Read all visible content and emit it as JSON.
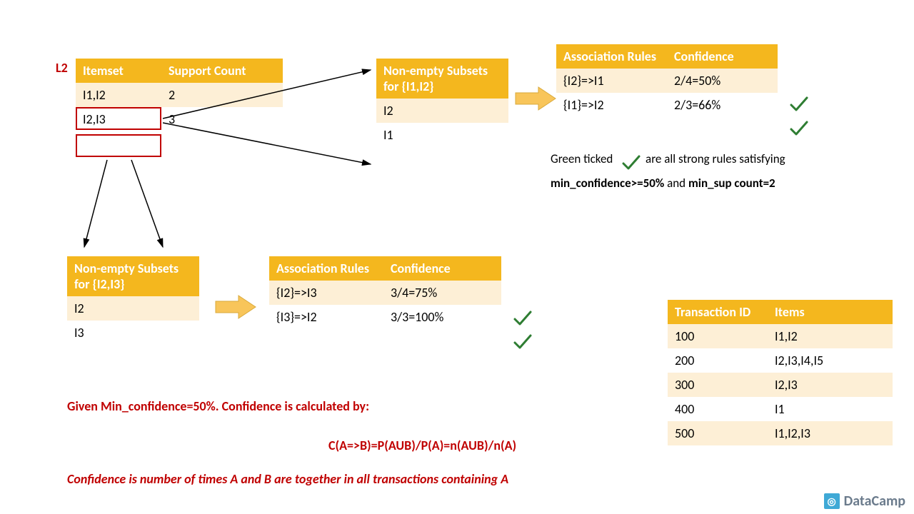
{
  "l2_label": "L2",
  "l2_table": {
    "headers": [
      "Itemset",
      "Support Count"
    ],
    "rows": [
      [
        "I1,I2",
        "2"
      ],
      [
        "I2,I3",
        "3"
      ]
    ]
  },
  "subset_i1i2": {
    "header": "Non-empty Subsets for {I1,I2}",
    "rows": [
      "I2",
      "I1"
    ]
  },
  "subset_i2i3": {
    "header": "Non-empty Subsets for {I2,I3}",
    "rows": [
      "I2",
      "I3"
    ]
  },
  "assoc_top": {
    "headers": [
      "Association Rules",
      "Confidence"
    ],
    "rows": [
      [
        "{I2}=>I1",
        "2/4=50%"
      ],
      [
        "{I1}=>I2",
        "2/3=66%"
      ]
    ]
  },
  "assoc_mid": {
    "headers": [
      "Association Rules",
      "Confidence"
    ],
    "rows": [
      [
        "{I2}=>I3",
        "3/4=75%"
      ],
      [
        "{I3}=>I2",
        "3/3=100%"
      ]
    ]
  },
  "trans": {
    "headers": [
      "Transaction ID",
      "Items"
    ],
    "rows": [
      [
        "100",
        "I1,I2"
      ],
      [
        "200",
        "I2,I3,I4,I5"
      ],
      [
        "300",
        "I2,I3"
      ],
      [
        "400",
        "I1"
      ],
      [
        "500",
        "I1,I2,I3"
      ]
    ]
  },
  "note1_a": "Green ticked",
  "note1_b": "are all strong rules satisfying",
  "note2_a": "min_confidence>=50%",
  "note2_mid": " and ",
  "note2_b": "min_sup count=2",
  "given": "Given Min_confidence=50%. Confidence is calculated by:",
  "formula": "C(A=>B)=P(AUB)/P(A)=n(AUB)/n(A)",
  "explain": "Confidence is number of times A and B are together in all transactions containing A",
  "logo": "DataCamp"
}
